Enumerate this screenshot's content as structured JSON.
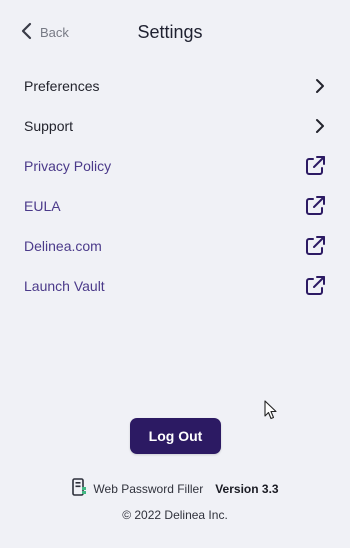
{
  "header": {
    "back_label": "Back",
    "title": "Settings"
  },
  "menu": {
    "items": [
      {
        "label": "Preferences",
        "type": "internal",
        "icon": "chevron-right-icon"
      },
      {
        "label": "Support",
        "type": "internal",
        "icon": "chevron-right-icon"
      },
      {
        "label": "Privacy Policy",
        "type": "external",
        "icon": "external-link-icon"
      },
      {
        "label": "EULA",
        "type": "external",
        "icon": "external-link-icon"
      },
      {
        "label": "Delinea.com",
        "type": "external",
        "icon": "external-link-icon"
      },
      {
        "label": "Launch Vault",
        "type": "external",
        "icon": "external-link-icon"
      }
    ]
  },
  "logout_label": "Log Out",
  "footer": {
    "product_icon": "product-logo-icon",
    "product_name": "Web Password Filler",
    "version": "Version 3.3",
    "copyright": "© 2022 Delinea Inc."
  },
  "colors": {
    "background": "#f0f1f6",
    "accent": "#2c1a63",
    "link": "#4b3a8a"
  }
}
